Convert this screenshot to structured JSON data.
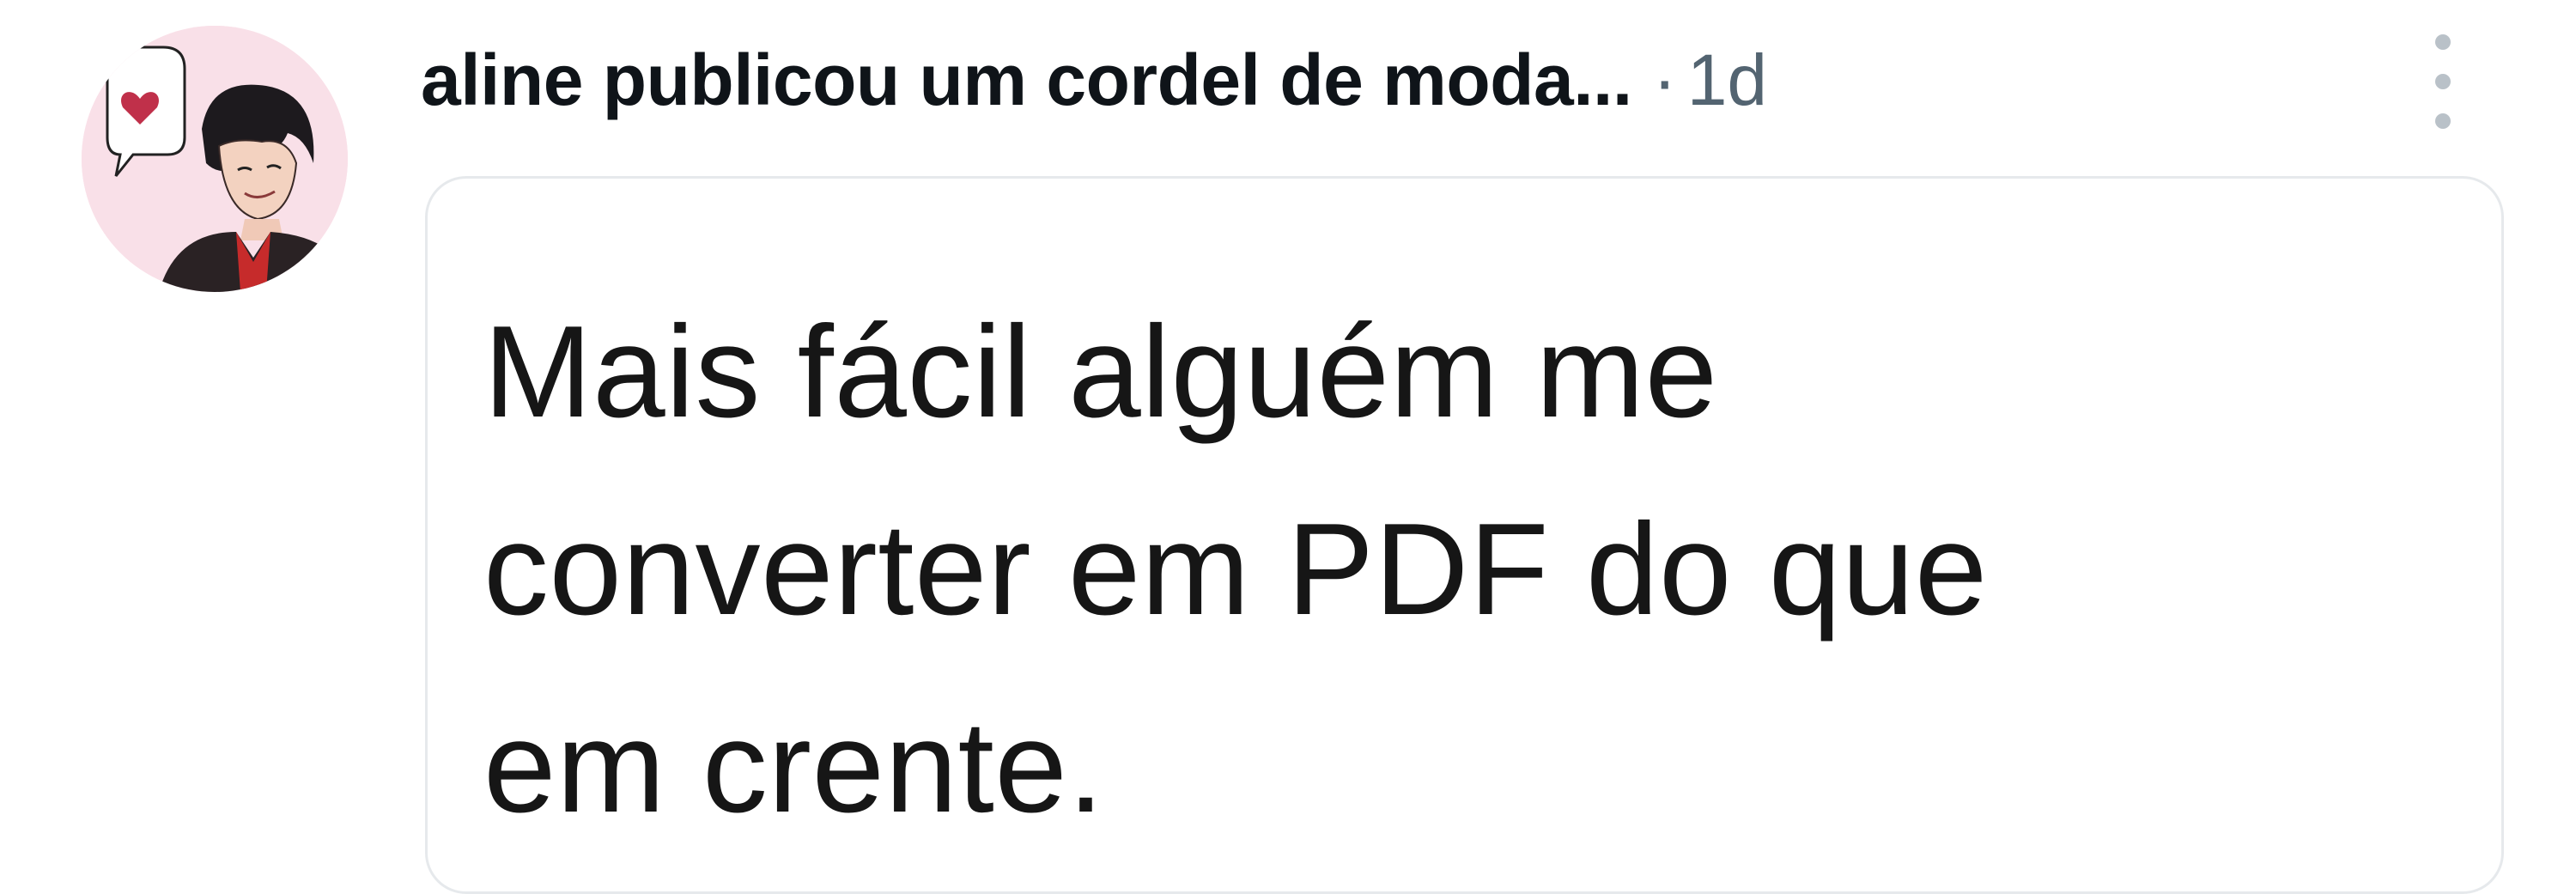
{
  "post": {
    "author": {
      "display_name": "aline publicou um cordel de moda...",
      "avatar_icon": "illustrated-portrait-avatar"
    },
    "separator": "·",
    "time": "1d",
    "more_icon": "vertical-ellipsis-icon",
    "media": {
      "lines": [
        "Mais fácil alguém me",
        "converter em PDF do que",
        "em crente."
      ]
    }
  },
  "colors": {
    "primary_text": "#0f1419",
    "secondary_text": "#536471",
    "card_border": "#e6e9ec",
    "more_dots": "#b9c1c8",
    "avatar_bg": "#fbe3ea"
  }
}
